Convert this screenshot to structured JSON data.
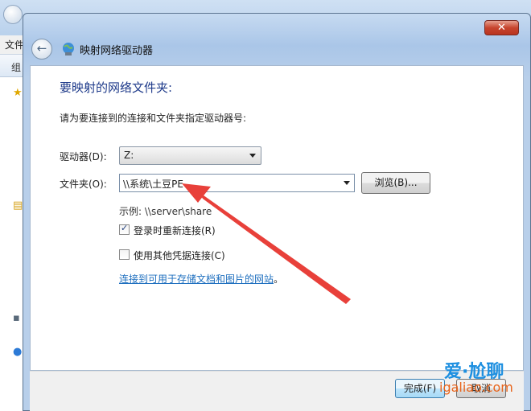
{
  "background": {
    "menu_text": "文件",
    "sub_text": "组"
  },
  "dialog": {
    "title": "映射网络驱动器",
    "close_label": "✕",
    "heading": "要映射的网络文件夹:",
    "description": "请为要连接到的连接和文件夹指定驱动器号:",
    "drive_label": "驱动器(D):",
    "drive_value": "Z:",
    "folder_label": "文件夹(O):",
    "folder_value": "\\\\系统\\土豆PE",
    "browse_label": "浏览(B)...",
    "example_text": "示例: \\\\server\\share",
    "reconnect_label": "登录时重新连接(R)",
    "reconnect_checked": true,
    "other_creds_label": "使用其他凭据连接(C)",
    "other_creds_checked": false,
    "link_text": "连接到可用于存储文档和图片的网站",
    "link_suffix": "。",
    "finish_label": "完成(F)",
    "cancel_label": "取消"
  },
  "watermark": {
    "top_text": "爱·尬聊",
    "bottom_text": "igaliao.com"
  },
  "colors": {
    "heading": "#1e3a8a",
    "link": "#1e6fbf",
    "arrow": "#e8403a"
  }
}
